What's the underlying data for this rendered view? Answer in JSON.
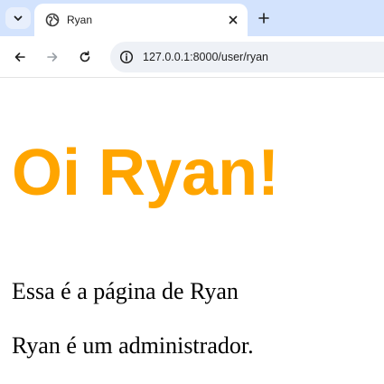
{
  "browser": {
    "tab": {
      "title": "Ryan"
    },
    "address_bar": {
      "url": "127.0.0.1:8000/user/ryan"
    },
    "icons": {
      "tab_search": "chevron-down-icon",
      "favicon": "globe-icon",
      "close": "close-icon",
      "new_tab": "plus-icon",
      "back": "arrow-left-icon",
      "forward": "arrow-right-icon",
      "reload": "reload-icon",
      "site_info": "info-icon"
    }
  },
  "page": {
    "heading": "Oi Ryan!",
    "heading_color": "#ffa500",
    "paragraph_1": "Essa é a página de Ryan",
    "paragraph_2": "Ryan é um administrador."
  }
}
